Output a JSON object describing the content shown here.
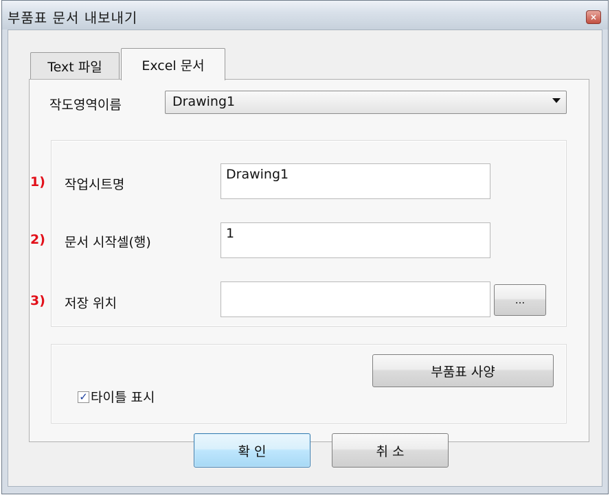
{
  "window": {
    "title": "부품표 문서 내보내기",
    "close_glyph": "×"
  },
  "tabs": [
    {
      "label": "Text 파일",
      "active": false
    },
    {
      "label": "Excel 문서",
      "active": true
    }
  ],
  "drawing_area": {
    "label": "작도영역이름",
    "selected": "Drawing1"
  },
  "fields": [
    {
      "number": "1)",
      "label": "작업시트명",
      "value": "Drawing1"
    },
    {
      "number": "2)",
      "label": "문서 시작셀(행)",
      "value": "1"
    },
    {
      "number": "3)",
      "label": "저장 위치",
      "value": ""
    }
  ],
  "browse_button": {
    "label": "..."
  },
  "options": {
    "show_title_label": "타이틀 표시",
    "show_title_checked": true,
    "spec_button_label": "부품표 사양"
  },
  "footer": {
    "ok_label": "확 인",
    "cancel_label": "취 소"
  },
  "colors": {
    "number_red": "#e2101a",
    "default_button_blue": "#a7d9f5",
    "checkmark": "#1c3f9e"
  }
}
